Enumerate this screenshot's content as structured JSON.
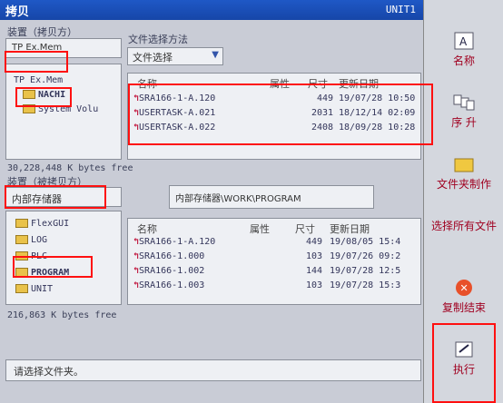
{
  "title": "拷贝",
  "unit": "UNIT1",
  "source": {
    "label": "装置（拷贝方）",
    "device": "TP Ex.Mem",
    "tree": [
      "TP Ex.Mem",
      "NACHI",
      "System Volu"
    ],
    "method_label": "文件选择方法",
    "method_value": "文件选择",
    "columns": {
      "name": "名称",
      "attr": "属性",
      "size": "尺寸",
      "date": "更新日期"
    },
    "files": [
      {
        "name": "SRA166-1-A.120",
        "size": "449",
        "date": "19/07/28 10:50"
      },
      {
        "name": "USERTASK-A.021",
        "size": "2031",
        "date": "18/12/14 02:09"
      },
      {
        "name": "USERTASK-A.022",
        "size": "2408",
        "date": "18/09/28 10:28"
      }
    ],
    "free": "30,228,448 K bytes free"
  },
  "dest": {
    "label": "装置（被拷贝方）",
    "device": "内部存储器",
    "tree": [
      "FlexGUI",
      "LOG",
      "PLC",
      "PROGRAM",
      "UNIT"
    ],
    "path": "内部存储器\\WORK\\PROGRAM",
    "columns": {
      "name": "名称",
      "attr": "属性",
      "size": "尺寸",
      "date": "更新日期"
    },
    "files": [
      {
        "name": "SRA166-1-A.120",
        "size": "449",
        "date": "19/08/05 15:4"
      },
      {
        "name": "SRA166-1.000",
        "size": "103",
        "date": "19/07/26 09:2"
      },
      {
        "name": "SRA166-1.002",
        "size": "144",
        "date": "19/07/28 12:5"
      },
      {
        "name": "SRA166-1.003",
        "size": "103",
        "date": "19/07/28 15:3"
      }
    ],
    "free": "216,863 K bytes free"
  },
  "status": "请选择文件夹。",
  "side": {
    "name": "名称",
    "sort": "序 升",
    "folder": "文件夹制作",
    "selectall": "选择所有文件",
    "end": "复制结束",
    "exec": "执行"
  },
  "colors": {
    "title": "#1f58c6",
    "highlight": "#ff1010"
  }
}
